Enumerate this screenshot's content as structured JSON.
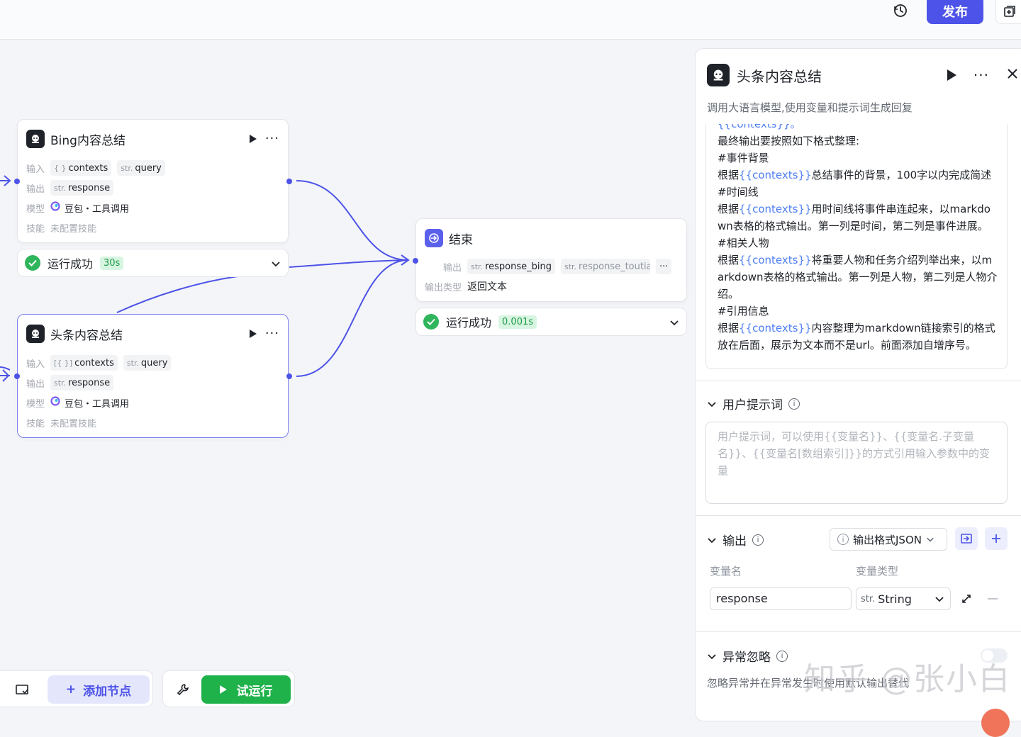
{
  "toolbar": {
    "publish_label": "发布"
  },
  "nodes": {
    "bing": {
      "title": "Bing内容总结",
      "input_label": "输入",
      "output_label": "输出",
      "model_label": "模型",
      "skill_label": "技能",
      "inputs": [
        {
          "type": "{ }",
          "name": "contexts"
        },
        {
          "type": "str.",
          "name": "query"
        }
      ],
      "outputs": [
        {
          "type": "str.",
          "name": "response"
        }
      ],
      "model": "豆包・工具调用",
      "skill": "未配置技能",
      "status": "运行成功",
      "duration": "30s"
    },
    "toutiao": {
      "title": "头条内容总结",
      "input_label": "输入",
      "output_label": "输出",
      "model_label": "模型",
      "skill_label": "技能",
      "inputs": [
        {
          "type": "[{ }]",
          "name": "contexts"
        },
        {
          "type": "str.",
          "name": "query"
        }
      ],
      "outputs": [
        {
          "type": "str.",
          "name": "response"
        }
      ],
      "model": "豆包・工具调用",
      "skill": "未配置技能"
    },
    "end": {
      "title": "结束",
      "output_label": "输出",
      "outputs": [
        {
          "type": "str.",
          "name": "response_bing"
        },
        {
          "type": "str.",
          "name": "response_toutia"
        }
      ],
      "output_type_label": "输出类型",
      "output_type": "返回文本",
      "status": "运行成功",
      "duration": "0.001s"
    }
  },
  "bottom": {
    "add_node": "添加节点",
    "trial_run": "试运行"
  },
  "panel": {
    "title": "头条内容总结",
    "description": "调用大语言模型,使用变量和提示词生成回复",
    "system_prompt": [
      {
        "t": "{{contexts}}。",
        "ref": true
      },
      {
        "t": "最终输出要按照如下格式整理:"
      },
      {
        "t": "#事件背景"
      },
      {
        "t": "根据{{contexts}}总结事件的背景，100字以内完成简述"
      },
      {
        "t": "#时间线"
      },
      {
        "t": "根据{{contexts}}用时间线将事件串连起来，以markdown表格的格式输出。第一列是时间，第二列是事件进展。"
      },
      {
        "t": "#相关人物"
      },
      {
        "t": "根据{{contexts}}将重要人物和任务介绍列举出来，以markdown表格的格式输出。第一列是人物，第二列是人物介绍。"
      },
      {
        "t": "#引用信息"
      },
      {
        "t": "根据{{contexts}}内容整理为markdown链接索引的格式放在后面，展示为文本而不是url。前面添加自增序号。"
      }
    ],
    "user_prompt": {
      "title": "用户提示词",
      "placeholder": "用户提示词，可以使用{{变量名}}、{{变量名.子变量名}}、{{变量名[数组索引]}}的方式引用输入参数中的变量"
    },
    "output": {
      "title": "输出",
      "format": "输出格式JSON",
      "col_name": "变量名",
      "col_type": "变量类型",
      "var_name": "response",
      "var_type_prefix": "str.",
      "var_type": "String"
    },
    "ignore": {
      "title": "异常忽略",
      "description": "忽略异常并在异常发生时使用默认输出替代"
    }
  },
  "watermark": "知乎 @张小白",
  "colors": {
    "accent": "#4d53e8",
    "success": "#2fb55c",
    "link": "#4d7ef2"
  }
}
